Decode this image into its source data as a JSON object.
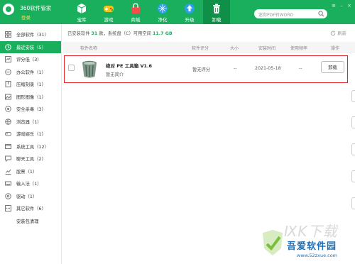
{
  "app": {
    "title": "360软件管家",
    "login": "登录",
    "accent": "#1aaf5d",
    "accent_dark": "#0f8f48"
  },
  "nav": [
    {
      "label": "宝库",
      "icon": "cube-icon"
    },
    {
      "label": "游戏",
      "icon": "gamepad-icon"
    },
    {
      "label": "商城",
      "icon": "shopping-bag-icon"
    },
    {
      "label": "净化",
      "icon": "shield-icon"
    },
    {
      "label": "升级",
      "icon": "upgrade-arrow-icon"
    },
    {
      "label": "卸载",
      "icon": "trash-icon",
      "active": true
    }
  ],
  "search": {
    "placeholder": "迷你PDF转WORD",
    "icon": "search-icon"
  },
  "window_controls": [
    "≡",
    "–",
    "×"
  ],
  "sidebar": [
    {
      "label": "全部软件（31）",
      "icon": "grid-icon"
    },
    {
      "label": "最近安装（5）",
      "icon": "clock-icon",
      "active": true
    },
    {
      "label": "评分低（3）",
      "icon": "rating-icon"
    },
    {
      "label": "办公软件（1）",
      "icon": "briefcase-icon"
    },
    {
      "label": "压缩刻录（1）",
      "icon": "compress-icon"
    },
    {
      "label": "图形图像（1）",
      "icon": "image-icon"
    },
    {
      "label": "安全杀毒（3）",
      "icon": "security-icon"
    },
    {
      "label": "浏览器（1）",
      "icon": "browser-icon"
    },
    {
      "label": "游戏娱乐（1）",
      "icon": "game-icon"
    },
    {
      "label": "系统工具（12）",
      "icon": "tools-icon"
    },
    {
      "label": "聊天工具（2）",
      "icon": "chat-icon"
    },
    {
      "label": "股票（1）",
      "icon": "stock-icon"
    },
    {
      "label": "输入法（1）",
      "icon": "keyboard-icon"
    },
    {
      "label": "驱动（1）",
      "icon": "driver-icon"
    },
    {
      "label": "其它软件（6）",
      "icon": "other-icon"
    },
    {
      "label": "安装包清理",
      "icon": "clean-icon"
    }
  ],
  "summary": {
    "prefix": "已安装软件",
    "count": "31",
    "mid": "款，系统盘（C）可用空间",
    "space": "11.7 GB"
  },
  "refresh_label": "刷新",
  "table": {
    "headers": [
      "软件名称",
      "软件评分",
      "大小",
      "安装时间",
      "使用频率",
      "操作"
    ],
    "rows": [
      {
        "name": "绝对 PE 工具箱 V1.6",
        "description": "暂无简介",
        "rating": "暂无评分",
        "size": "--",
        "install_date": "2021-05-18",
        "frequency": "--",
        "action": "卸载"
      }
    ]
  },
  "watermark": {
    "top": "ⅨK下载",
    "main": "吾爱软件园",
    "url": "www.52zxue.com"
  }
}
